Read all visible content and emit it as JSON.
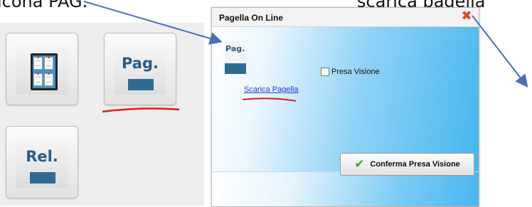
{
  "annotations": {
    "left_caption": "icona PAG.",
    "right_caption": "scarica pagella"
  },
  "tiles": [
    {
      "icon": "bulletin-board-icon"
    },
    {
      "caption": "Pag.",
      "icon": "pag-icon"
    },
    {
      "caption": "Rel.",
      "icon": "rel-icon"
    }
  ],
  "dialog": {
    "title": "Pagella On Line",
    "icon_label": "Pag.",
    "download_link": "Scarica Pagella",
    "acknowledge_label": "Presa Visione",
    "confirm_button": "Conferma Presa Visione"
  },
  "colors": {
    "annotation_arrow": "#4a6fb8",
    "underline": "#e0191a",
    "close_icon": "#e8412b",
    "icon_bar": "#2e6b93",
    "dialog_gradient_end": "#45b6ef"
  }
}
